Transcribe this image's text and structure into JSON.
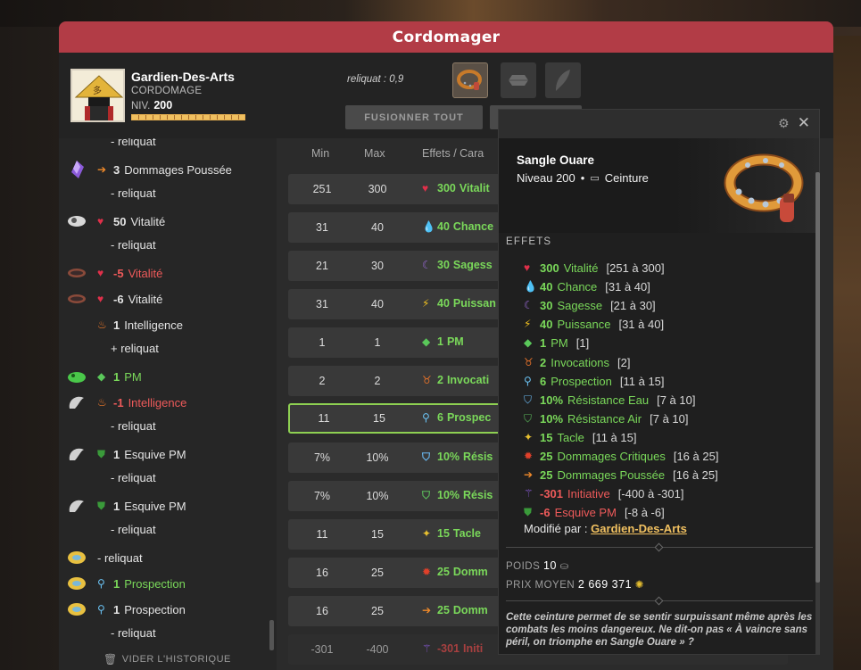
{
  "window": {
    "title": "Cordomager"
  },
  "character": {
    "name": "Gardien-Des-Arts",
    "job": "CORDOMAGE",
    "level_label": "NIV.",
    "level": "200",
    "xp_fraction": 1.0
  },
  "header": {
    "reliquat": "reliquat : 0,9",
    "fuse_all": "FUSIONNER TOUT"
  },
  "history": {
    "clear_label": "VIDER L'HISTORIQUE",
    "rows": [
      {
        "text": "- reliquat"
      },
      {
        "num": "3",
        "text": "Dommages Poussée"
      },
      {
        "text": "- reliquat"
      },
      {
        "num": "50",
        "text": "Vitalité"
      },
      {
        "text": "- reliquat"
      },
      {
        "num": "-5",
        "text": "Vitalité"
      },
      {
        "num": "-6",
        "text": "Vitalité"
      },
      {
        "num": "1",
        "text": "Intelligence"
      },
      {
        "text": "+ reliquat"
      },
      {
        "num": "1",
        "text": "PM"
      },
      {
        "num": "-1",
        "text": "Intelligence"
      },
      {
        "text": "- reliquat"
      },
      {
        "num": "1",
        "text": "Esquive PM"
      },
      {
        "text": "- reliquat"
      },
      {
        "num": "1",
        "text": "Esquive PM"
      },
      {
        "text": "- reliquat"
      },
      {
        "text": "- reliquat"
      },
      {
        "num": "1",
        "text": "Prospection"
      },
      {
        "num": "1",
        "text": "Prospection"
      },
      {
        "text": "- reliquat"
      }
    ]
  },
  "table": {
    "headers": {
      "min": "Min",
      "max": "Max",
      "effects": "Effets / Cara"
    },
    "rows": [
      {
        "min": "251",
        "max": "300",
        "num": "300",
        "label": "Vitalit"
      },
      {
        "min": "31",
        "max": "40",
        "num": "40",
        "label": "Chance"
      },
      {
        "min": "21",
        "max": "30",
        "num": "30",
        "label": "Sagess"
      },
      {
        "min": "31",
        "max": "40",
        "num": "40",
        "label": "Puissan"
      },
      {
        "min": "1",
        "max": "1",
        "num": "1",
        "label": "PM"
      },
      {
        "min": "2",
        "max": "2",
        "num": "2",
        "label": "Invocati"
      },
      {
        "min": "11",
        "max": "15",
        "num": "6",
        "label": "Prospec"
      },
      {
        "min": "7%",
        "max": "10%",
        "num": "10%",
        "label": "Résis"
      },
      {
        "min": "7%",
        "max": "10%",
        "num": "10%",
        "label": "Résis"
      },
      {
        "min": "11",
        "max": "15",
        "num": "15",
        "label": "Tacle"
      },
      {
        "min": "16",
        "max": "25",
        "num": "25",
        "label": "Domm"
      },
      {
        "min": "16",
        "max": "25",
        "num": "25",
        "label": "Domm"
      },
      {
        "min": "-301",
        "max": "-400",
        "num": "-301",
        "label": "Initi"
      }
    ]
  },
  "tooltip": {
    "name": "Sangle Ouare",
    "level": "Niveau 200",
    "dot": "•",
    "type": "Ceinture",
    "effects_title": "EFFETS",
    "effects": [
      {
        "num": "300",
        "label": "Vitalité",
        "range": "[251 à 300]"
      },
      {
        "num": "40",
        "label": "Chance",
        "range": "[31 à 40]"
      },
      {
        "num": "30",
        "label": "Sagesse",
        "range": "[21 à 30]"
      },
      {
        "num": "40",
        "label": "Puissance",
        "range": "[31 à 40]"
      },
      {
        "num": "1",
        "label": "PM",
        "range": "[1]"
      },
      {
        "num": "2",
        "label": "Invocations",
        "range": "[2]"
      },
      {
        "num": "6",
        "label": "Prospection",
        "range": "[11 à 15]"
      },
      {
        "num": "10%",
        "label": "Résistance Eau",
        "range": "[7 à 10]"
      },
      {
        "num": "10%",
        "label": "Résistance Air",
        "range": "[7 à 10]"
      },
      {
        "num": "15",
        "label": "Tacle",
        "range": "[11 à 15]"
      },
      {
        "num": "25",
        "label": "Dommages Critiques",
        "range": "[16 à 25]"
      },
      {
        "num": "25",
        "label": "Dommages Poussée",
        "range": "[16 à 25]"
      },
      {
        "num": "-301",
        "label": "Initiative",
        "range": "[-400 à -301]"
      },
      {
        "num": "-6",
        "label": "Esquive PM",
        "range": "[-8 à -6]"
      }
    ],
    "modified_by_label": "Modifié par :",
    "modified_by": "Gardien-Des-Arts",
    "weight_label": "POIDS",
    "weight": "10",
    "price_label": "PRIX MOYEN",
    "price": "2 669 371",
    "description": "Cette ceinture permet de se sentir surpuissant même après les combats les moins dangereux. Ne dit-on pas « À vaincre sans péril, on triomphe en Sangle Ouare » ?"
  },
  "colors": {
    "title_bar": "#b23c46",
    "positive": "#7ad85a",
    "negative": "#ee5a5a",
    "link": "#f0c060"
  }
}
